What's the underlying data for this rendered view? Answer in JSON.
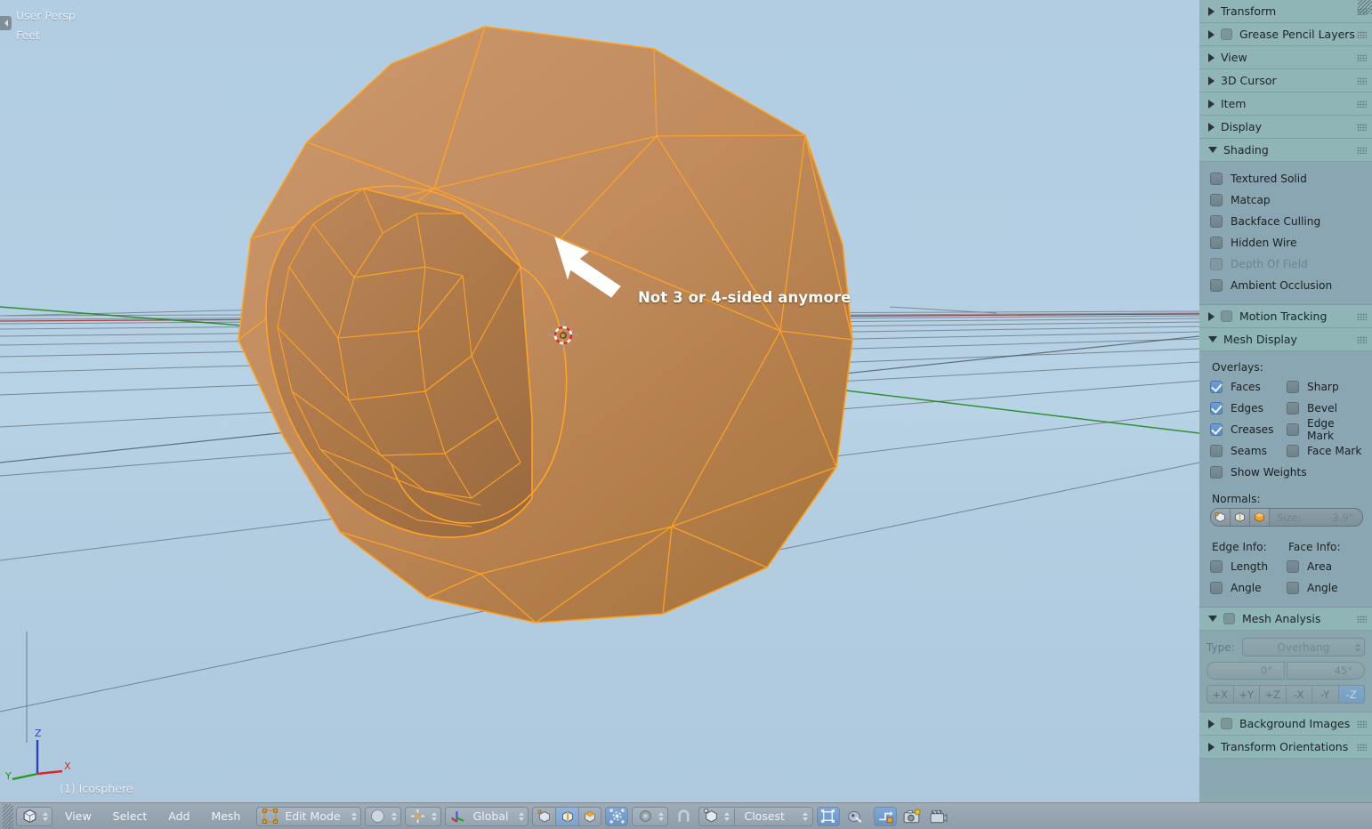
{
  "viewport": {
    "perspective_label": "User Persp",
    "units_label": "Feet",
    "object_name": "(1) Icosphere",
    "annotation": "Not 3 or 4-sided anymore",
    "axis_gizmo": {
      "z": "Z",
      "y": "Y",
      "x": "X"
    },
    "colors": {
      "sky_top": "#b2cde1",
      "sky_bottom": "#aec9de",
      "mesh_fill": "#c08a56",
      "mesh_edge": "#ffa01e",
      "annotation_text": "#ffffff",
      "cursor_red": "#d82b2b",
      "axis_green": "#1f8a1f",
      "axis_red": "#9e2a2a"
    }
  },
  "properties_panel": {
    "panels": [
      {
        "name": "Transform",
        "label": "Transform",
        "open": false,
        "has_checkbox": false
      },
      {
        "name": "Grease Pencil Layers",
        "label": "Grease Pencil Layers",
        "open": false,
        "has_checkbox": true
      },
      {
        "name": "View",
        "label": "View",
        "open": false,
        "has_checkbox": false
      },
      {
        "name": "3D Cursor",
        "label": "3D Cursor",
        "open": false,
        "has_checkbox": false
      },
      {
        "name": "Item",
        "label": "Item",
        "open": false,
        "has_checkbox": false
      },
      {
        "name": "Display",
        "label": "Display",
        "open": false,
        "has_checkbox": false
      }
    ],
    "shading": {
      "title": "Shading",
      "open": true,
      "options": [
        {
          "label": "Textured Solid",
          "checked": false,
          "enabled": true
        },
        {
          "label": "Matcap",
          "checked": false,
          "enabled": true
        },
        {
          "label": "Backface Culling",
          "checked": false,
          "enabled": true
        },
        {
          "label": "Hidden Wire",
          "checked": false,
          "enabled": true
        },
        {
          "label": "Depth Of Field",
          "checked": false,
          "enabled": false
        },
        {
          "label": "Ambient Occlusion",
          "checked": false,
          "enabled": true
        }
      ]
    },
    "motion_tracking": {
      "label": "Motion Tracking",
      "open": false,
      "has_checkbox": true
    },
    "mesh_display": {
      "title": "Mesh Display",
      "open": true,
      "overlays_label": "Overlays:",
      "overlays_left": [
        {
          "label": "Faces",
          "checked": true
        },
        {
          "label": "Edges",
          "checked": true
        },
        {
          "label": "Creases",
          "checked": true
        },
        {
          "label": "Seams",
          "checked": false
        },
        {
          "label": "Show Weights",
          "checked": false
        }
      ],
      "overlays_right": [
        {
          "label": "Sharp",
          "checked": false
        },
        {
          "label": "Bevel",
          "checked": false
        },
        {
          "label": "Edge Mark",
          "checked": false
        },
        {
          "label": "Face Mark",
          "checked": false
        }
      ],
      "normals_label": "Normals:",
      "normals_buttons": [
        "vertex-normals-icon",
        "split-normals-icon",
        "face-normals-icon"
      ],
      "size_label": "Size:",
      "size_value": "3.9\"",
      "edge_info_label": "Edge Info:",
      "edge_info": [
        {
          "label": "Length",
          "checked": false
        },
        {
          "label": "Angle",
          "checked": false
        }
      ],
      "face_info_label": "Face Info:",
      "face_info": [
        {
          "label": "Area",
          "checked": false
        },
        {
          "label": "Angle",
          "checked": false
        }
      ]
    },
    "mesh_analysis": {
      "title": "Mesh Analysis",
      "open": true,
      "enabled": false,
      "type_label": "Type:",
      "type_value": "Overhang",
      "range_min": "0°",
      "range_max": "45°",
      "axes": [
        {
          "label": "+X",
          "active": false
        },
        {
          "label": "+Y",
          "active": false
        },
        {
          "label": "+Z",
          "active": false
        },
        {
          "label": "-X",
          "active": false
        },
        {
          "label": "-Y",
          "active": false
        },
        {
          "label": "-Z",
          "active": true
        }
      ]
    },
    "background_images": {
      "label": "Background Images",
      "open": false,
      "has_checkbox": true
    },
    "transform_orientations": {
      "label": "Transform Orientations",
      "open": false,
      "has_checkbox": false
    }
  },
  "toolbar": {
    "editor_type_icon": "editor-type-3dview-icon",
    "menus": [
      "View",
      "Select",
      "Add",
      "Mesh"
    ],
    "mode": {
      "label": "Edit Mode",
      "icon": "edit-mode-icon"
    },
    "viewport_shading": {
      "icon": "solid-shading-icon"
    },
    "pivot": {
      "icon": "pivot-median-point-icon"
    },
    "orientation": {
      "label": "Global",
      "icon": "orientation-axis-icon"
    },
    "select_modes": [
      {
        "name": "vertex-select-mode",
        "active": false
      },
      {
        "name": "edge-select-mode",
        "active": true
      },
      {
        "name": "face-select-mode",
        "active": false
      }
    ],
    "proportional_edit": {
      "name": "proportional-edit-objects-icon",
      "active": true
    },
    "proportional_falloff": {
      "name": "smooth-falloff-icon",
      "active": false
    },
    "snap_magnet": {
      "name": "snap-magnet-icon",
      "active": false
    },
    "snap_element": {
      "name": "snap-vertex-icon"
    },
    "snap_target": {
      "label": "Closest"
    },
    "snap_onto_self": {
      "name": "snap-onto-self-icon",
      "active": true
    },
    "snap_project": {
      "name": "project-individual-elements-icon",
      "active": false
    },
    "auto_merge": {
      "name": "auto-merge-editing-icon",
      "active": true
    },
    "render_image": {
      "name": "render-image-icon"
    },
    "render_animation": {
      "name": "render-animation-icon"
    }
  }
}
